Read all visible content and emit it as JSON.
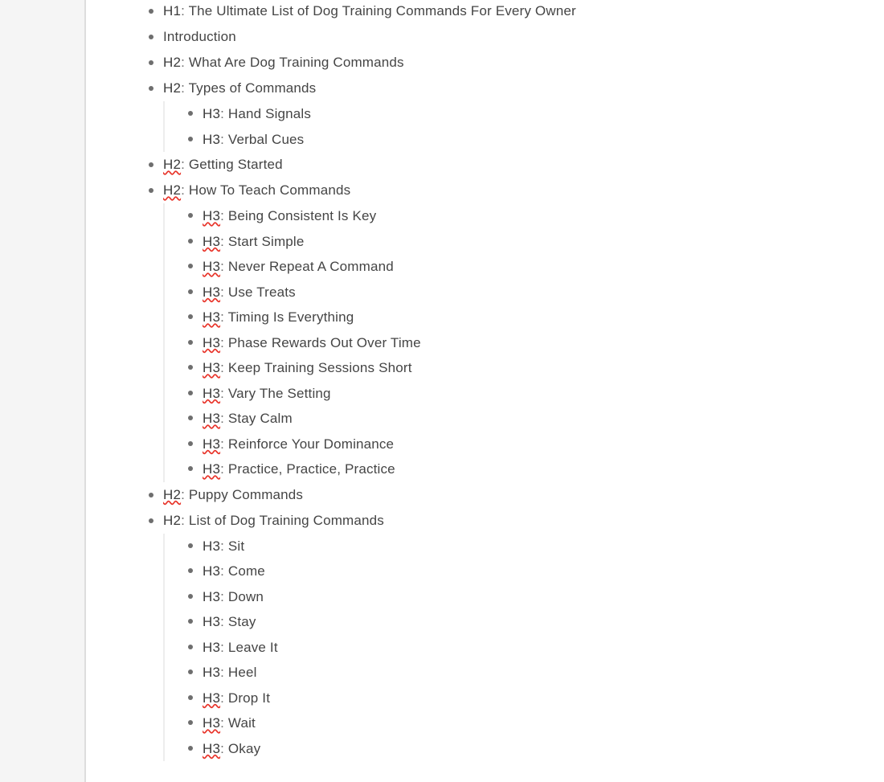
{
  "panel": {
    "gutter_background": "#f5f5f5",
    "gutter_border": "#dddddd",
    "content_background": "#ffffff"
  },
  "theme": {
    "text_color": "#444444",
    "bullet_color": "#6e6e6e",
    "guide_line_color": "#ededed",
    "spellcheck_underline_color": "#e8342a"
  },
  "outline": {
    "items": [
      {
        "tag": "H1",
        "misspelled": false,
        "label": "The Ultimate List of Dog Training Commands For Every Owner",
        "children": []
      },
      {
        "tag": "",
        "misspelled": false,
        "label": "Introduction",
        "children": []
      },
      {
        "tag": "H2",
        "misspelled": false,
        "label": "What Are Dog Training Commands",
        "children": []
      },
      {
        "tag": "H2",
        "misspelled": false,
        "label": "Types of Commands",
        "children": [
          {
            "tag": "H3",
            "misspelled": false,
            "label": "Hand Signals"
          },
          {
            "tag": "H3",
            "misspelled": false,
            "label": "Verbal Cues"
          }
        ]
      },
      {
        "tag": "H2",
        "misspelled": true,
        "label": "Getting Started",
        "children": []
      },
      {
        "tag": "H2",
        "misspelled": true,
        "label": "How To Teach Commands",
        "children": [
          {
            "tag": "H3",
            "misspelled": true,
            "label": "Being Consistent Is Key"
          },
          {
            "tag": "H3",
            "misspelled": true,
            "label": "Start Simple"
          },
          {
            "tag": "H3",
            "misspelled": true,
            "label": "Never Repeat A Command"
          },
          {
            "tag": "H3",
            "misspelled": true,
            "label": "Use Treats"
          },
          {
            "tag": "H3",
            "misspelled": true,
            "label": "Timing Is Everything"
          },
          {
            "tag": "H3",
            "misspelled": true,
            "label": "Phase Rewards Out Over Time"
          },
          {
            "tag": "H3",
            "misspelled": true,
            "label": "Keep Training Sessions Short"
          },
          {
            "tag": "H3",
            "misspelled": true,
            "label": "Vary The Setting"
          },
          {
            "tag": "H3",
            "misspelled": true,
            "label": "Stay Calm"
          },
          {
            "tag": "H3",
            "misspelled": true,
            "label": "Reinforce Your Dominance"
          },
          {
            "tag": "H3",
            "misspelled": true,
            "label": "Practice, Practice, Practice"
          }
        ]
      },
      {
        "tag": "H2",
        "misspelled": true,
        "label": "Puppy Commands",
        "children": []
      },
      {
        "tag": "H2",
        "misspelled": false,
        "label": "List of Dog Training Commands",
        "children": [
          {
            "tag": "H3",
            "misspelled": false,
            "label": "Sit"
          },
          {
            "tag": "H3",
            "misspelled": false,
            "label": "Come"
          },
          {
            "tag": "H3",
            "misspelled": false,
            "label": "Down"
          },
          {
            "tag": "H3",
            "misspelled": false,
            "label": "Stay"
          },
          {
            "tag": "H3",
            "misspelled": false,
            "label": "Leave It"
          },
          {
            "tag": "H3",
            "misspelled": false,
            "label": "Heel"
          },
          {
            "tag": "H3",
            "misspelled": true,
            "label": "Drop It"
          },
          {
            "tag": "H3",
            "misspelled": true,
            "label": "Wait"
          },
          {
            "tag": "H3",
            "misspelled": true,
            "label": "Okay"
          }
        ]
      }
    ]
  }
}
